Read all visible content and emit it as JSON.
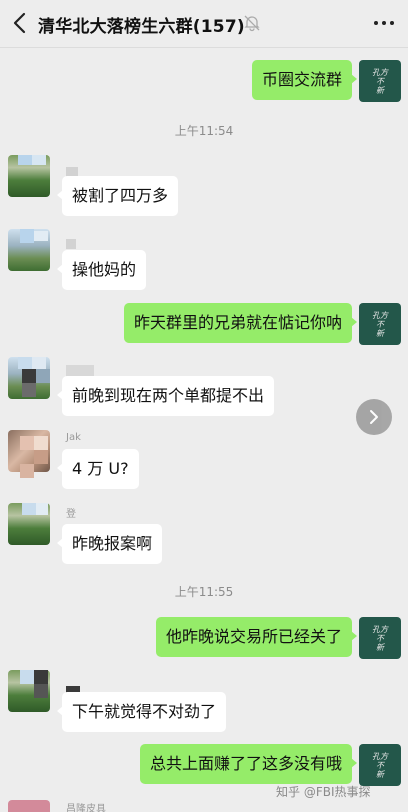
{
  "header": {
    "title": "清华北大落榜生六群(157)",
    "back_icon": "chevron-left-icon",
    "mute_icon": "bell-muted-icon",
    "more_icon": "ellipsis-icon"
  },
  "my_avatar_lines": [
    "孔方",
    "兄弟",
    "不",
    "贵",
    "新",
    "事"
  ],
  "messages": [
    {
      "side": "right",
      "text": "币圈交流群"
    },
    {
      "type": "time",
      "text": "上午11:54"
    },
    {
      "side": "left",
      "name": "",
      "text": "被割了四万多"
    },
    {
      "side": "left",
      "name": "",
      "text": "操他妈的"
    },
    {
      "side": "right",
      "text": "昨天群里的兄弟就在惦记你呐"
    },
    {
      "side": "left",
      "name": "",
      "text": "前晚到现在两个单都提不出"
    },
    {
      "side": "left",
      "name": "Jak",
      "text": "4 万 U?"
    },
    {
      "side": "left",
      "name": "登",
      "text": "昨晚报案啊"
    },
    {
      "type": "time",
      "text": "上午11:55"
    },
    {
      "side": "right",
      "text": "他昨晚说交易所已经关了"
    },
    {
      "side": "left",
      "name": "",
      "text": "下午就觉得不对劲了"
    },
    {
      "side": "right",
      "text": "总共上面赚了了这多没有哦"
    }
  ],
  "partial_next_name": "昌隆皮具",
  "watermark": "知乎 @FBI热事探",
  "colors": {
    "self_bubble": "#95ec69",
    "other_bubble": "#ffffff",
    "background": "#ededed"
  }
}
